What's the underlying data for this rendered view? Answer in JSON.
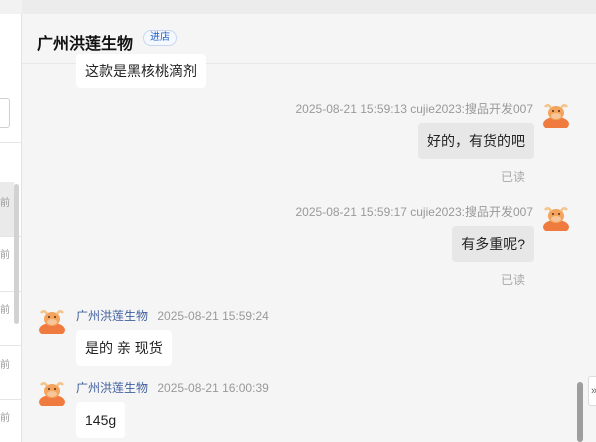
{
  "left_list": {
    "times": [
      "前",
      "前",
      "前",
      "前",
      "前"
    ]
  },
  "chat": {
    "shop_name": "广州洪莲生物",
    "enter_label": "进店",
    "messages": [
      {
        "text": "这款是黑核桃滴剂"
      },
      {
        "meta": "2025-08-21 15:59:13  cujie2023:搜品开发007",
        "text": "好的，有货的吧",
        "status": "已读"
      },
      {
        "meta": "2025-08-21 15:59:17  cujie2023:搜品开发007",
        "text": "有多重呢?",
        "status": "已读"
      },
      {
        "sender": "广州洪莲生物",
        "time": "2025-08-21 15:59:24",
        "text": "是的 亲  现货"
      },
      {
        "sender": "广州洪莲生物",
        "time": "2025-08-21 16:00:39",
        "text": "145g"
      }
    ]
  },
  "side_tab_label": "»",
  "colors": {
    "accent": "#1f5fbf",
    "sender_name": "#405f9e",
    "avatar": "#f07b3f"
  }
}
